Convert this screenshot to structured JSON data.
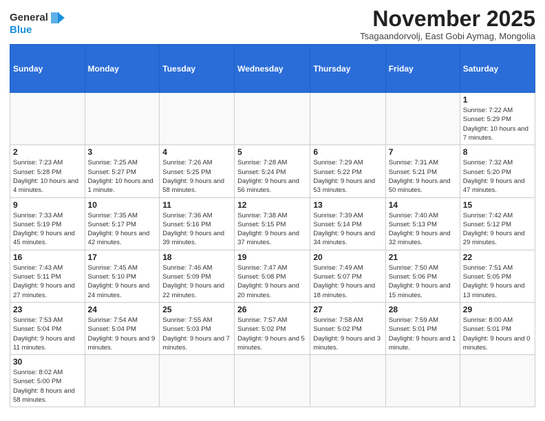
{
  "logo": {
    "text_general": "General",
    "text_blue": "Blue"
  },
  "title": "November 2025",
  "subtitle": "Tsagaandorvolj, East Gobi Aymag, Mongolia",
  "weekdays": [
    "Sunday",
    "Monday",
    "Tuesday",
    "Wednesday",
    "Thursday",
    "Friday",
    "Saturday"
  ],
  "weeks": [
    [
      {
        "day": "",
        "info": ""
      },
      {
        "day": "",
        "info": ""
      },
      {
        "day": "",
        "info": ""
      },
      {
        "day": "",
        "info": ""
      },
      {
        "day": "",
        "info": ""
      },
      {
        "day": "",
        "info": ""
      },
      {
        "day": "1",
        "info": "Sunrise: 7:22 AM\nSunset: 5:29 PM\nDaylight: 10 hours and 7 minutes."
      }
    ],
    [
      {
        "day": "2",
        "info": "Sunrise: 7:23 AM\nSunset: 5:28 PM\nDaylight: 10 hours and 4 minutes."
      },
      {
        "day": "3",
        "info": "Sunrise: 7:25 AM\nSunset: 5:27 PM\nDaylight: 10 hours and 1 minute."
      },
      {
        "day": "4",
        "info": "Sunrise: 7:26 AM\nSunset: 5:25 PM\nDaylight: 9 hours and 58 minutes."
      },
      {
        "day": "5",
        "info": "Sunrise: 7:28 AM\nSunset: 5:24 PM\nDaylight: 9 hours and 56 minutes."
      },
      {
        "day": "6",
        "info": "Sunrise: 7:29 AM\nSunset: 5:22 PM\nDaylight: 9 hours and 53 minutes."
      },
      {
        "day": "7",
        "info": "Sunrise: 7:31 AM\nSunset: 5:21 PM\nDaylight: 9 hours and 50 minutes."
      },
      {
        "day": "8",
        "info": "Sunrise: 7:32 AM\nSunset: 5:20 PM\nDaylight: 9 hours and 47 minutes."
      }
    ],
    [
      {
        "day": "9",
        "info": "Sunrise: 7:33 AM\nSunset: 5:19 PM\nDaylight: 9 hours and 45 minutes."
      },
      {
        "day": "10",
        "info": "Sunrise: 7:35 AM\nSunset: 5:17 PM\nDaylight: 9 hours and 42 minutes."
      },
      {
        "day": "11",
        "info": "Sunrise: 7:36 AM\nSunset: 5:16 PM\nDaylight: 9 hours and 39 minutes."
      },
      {
        "day": "12",
        "info": "Sunrise: 7:38 AM\nSunset: 5:15 PM\nDaylight: 9 hours and 37 minutes."
      },
      {
        "day": "13",
        "info": "Sunrise: 7:39 AM\nSunset: 5:14 PM\nDaylight: 9 hours and 34 minutes."
      },
      {
        "day": "14",
        "info": "Sunrise: 7:40 AM\nSunset: 5:13 PM\nDaylight: 9 hours and 32 minutes."
      },
      {
        "day": "15",
        "info": "Sunrise: 7:42 AM\nSunset: 5:12 PM\nDaylight: 9 hours and 29 minutes."
      }
    ],
    [
      {
        "day": "16",
        "info": "Sunrise: 7:43 AM\nSunset: 5:11 PM\nDaylight: 9 hours and 27 minutes."
      },
      {
        "day": "17",
        "info": "Sunrise: 7:45 AM\nSunset: 5:10 PM\nDaylight: 9 hours and 24 minutes."
      },
      {
        "day": "18",
        "info": "Sunrise: 7:46 AM\nSunset: 5:09 PM\nDaylight: 9 hours and 22 minutes."
      },
      {
        "day": "19",
        "info": "Sunrise: 7:47 AM\nSunset: 5:08 PM\nDaylight: 9 hours and 20 minutes."
      },
      {
        "day": "20",
        "info": "Sunrise: 7:49 AM\nSunset: 5:07 PM\nDaylight: 9 hours and 18 minutes."
      },
      {
        "day": "21",
        "info": "Sunrise: 7:50 AM\nSunset: 5:06 PM\nDaylight: 9 hours and 15 minutes."
      },
      {
        "day": "22",
        "info": "Sunrise: 7:51 AM\nSunset: 5:05 PM\nDaylight: 9 hours and 13 minutes."
      }
    ],
    [
      {
        "day": "23",
        "info": "Sunrise: 7:53 AM\nSunset: 5:04 PM\nDaylight: 9 hours and 11 minutes."
      },
      {
        "day": "24",
        "info": "Sunrise: 7:54 AM\nSunset: 5:04 PM\nDaylight: 9 hours and 9 minutes."
      },
      {
        "day": "25",
        "info": "Sunrise: 7:55 AM\nSunset: 5:03 PM\nDaylight: 9 hours and 7 minutes."
      },
      {
        "day": "26",
        "info": "Sunrise: 7:57 AM\nSunset: 5:02 PM\nDaylight: 9 hours and 5 minutes."
      },
      {
        "day": "27",
        "info": "Sunrise: 7:58 AM\nSunset: 5:02 PM\nDaylight: 9 hours and 3 minutes."
      },
      {
        "day": "28",
        "info": "Sunrise: 7:59 AM\nSunset: 5:01 PM\nDaylight: 9 hours and 1 minute."
      },
      {
        "day": "29",
        "info": "Sunrise: 8:00 AM\nSunset: 5:01 PM\nDaylight: 9 hours and 0 minutes."
      }
    ],
    [
      {
        "day": "30",
        "info": "Sunrise: 8:02 AM\nSunset: 5:00 PM\nDaylight: 8 hours and 58 minutes."
      },
      {
        "day": "",
        "info": ""
      },
      {
        "day": "",
        "info": ""
      },
      {
        "day": "",
        "info": ""
      },
      {
        "day": "",
        "info": ""
      },
      {
        "day": "",
        "info": ""
      },
      {
        "day": "",
        "info": ""
      }
    ]
  ]
}
